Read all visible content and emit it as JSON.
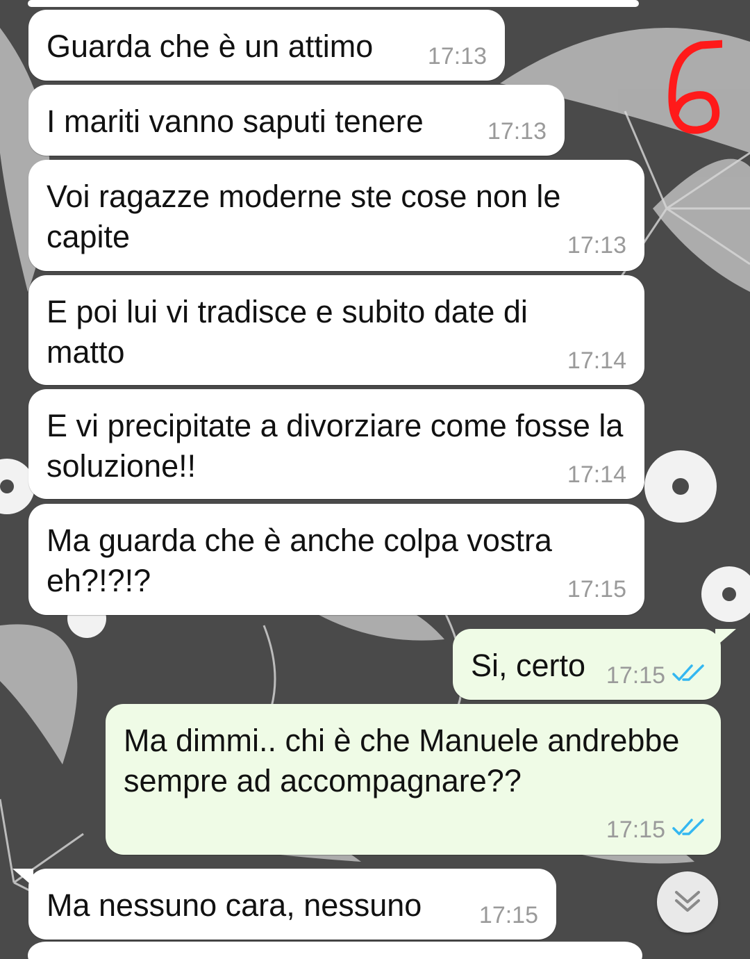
{
  "annotation": {
    "mark_label": "6",
    "color": "#ff1a1a"
  },
  "messages": [
    {
      "dir": "in",
      "text": "Guarda che è un attimo",
      "time": "17:13"
    },
    {
      "dir": "in",
      "text": "I mariti vanno saputi tenere",
      "time": "17:13"
    },
    {
      "dir": "in",
      "text": "Voi ragazze moderne ste cose non le capite",
      "time": "17:13"
    },
    {
      "dir": "in",
      "text": "E poi lui vi tradisce e subito date di matto",
      "time": "17:14"
    },
    {
      "dir": "in",
      "text": "E vi precipitate a divorziare come fosse la soluzione!!",
      "time": "17:14"
    },
    {
      "dir": "in",
      "text": "Ma guarda che è anche colpa vostra eh?!?!?",
      "time": "17:15"
    },
    {
      "dir": "out",
      "text": "Si, certo",
      "time": "17:15",
      "status": "read"
    },
    {
      "dir": "out",
      "text": "Ma dimmi.. chi è che Manuele andrebbe sempre ad accompagnare??",
      "time": "17:15",
      "status": "read"
    },
    {
      "dir": "in",
      "text": "Ma nessuno cara, nessuno",
      "time": "17:15"
    }
  ],
  "icons": {
    "read_receipt": "double-check-icon",
    "scroll": "chevron-down-double-icon"
  },
  "colors": {
    "incoming": "#ffffff",
    "outgoing": "#effbe6",
    "read_tick": "#34b7f1",
    "timestamp": "#9a9a9a"
  }
}
